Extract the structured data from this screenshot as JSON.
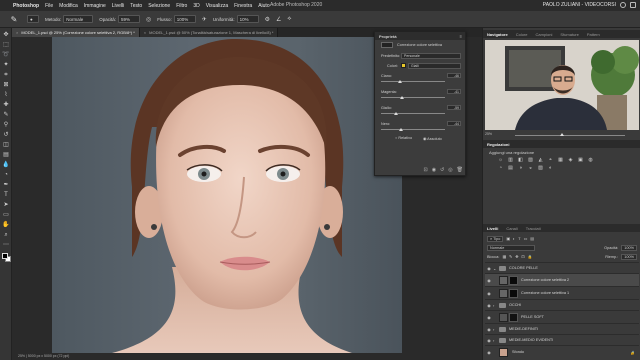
{
  "menubar": {
    "app": "Photoshop",
    "items": [
      "File",
      "Modifica",
      "Immagine",
      "Livelli",
      "Testo",
      "Selezione",
      "Filtro",
      "3D",
      "Visualizza",
      "Finestra",
      "Aiuto"
    ],
    "title": "Adobe Photoshop 2020",
    "user": "PAOLO ZULIANI - VIDEOCORSI"
  },
  "options": {
    "mode_label": "Metodo:",
    "mode_value": "Normale",
    "opacity_label": "Opacità:",
    "opacity_value": "59%",
    "flow_label": "Flusso:",
    "flow_value": "100%",
    "smooth_label": "Uniformità:",
    "smooth_value": "10%"
  },
  "tabs": [
    {
      "label": "MODEL_1.psd @ 25% (Correzione colore selettiva 2, RGB/8*) *",
      "active": true
    },
    {
      "label": "MODEL_1.psd @ 50% (Tonalità/saturazione 1, Maschera di livello/8) *",
      "active": false
    }
  ],
  "status": "25% | 5000 px x 5000 px (72 ppi)",
  "properties": {
    "panel_title": "Proprietà",
    "type_label": "Correzione colore selettiva",
    "preset_label": "Predefinito:",
    "preset_value": "Personale",
    "colors_label": "Colori:",
    "colors_value": "Gialli",
    "colors_swatch": "#e8c82a",
    "sliders": [
      {
        "label": "Ciano:",
        "value": "-46",
        "percent": "%"
      },
      {
        "label": "Magenta:",
        "value": "-41",
        "percent": "%"
      },
      {
        "label": "Giallo:",
        "value": "-59",
        "percent": "%"
      },
      {
        "label": "Nero:",
        "value": "-44",
        "percent": "%"
      }
    ],
    "method_relative": "Relativo",
    "method_absolute": "Assoluto"
  },
  "navigator": {
    "tabs": [
      "Navigatore",
      "Colore",
      "Campioni",
      "Sfumature",
      "Pattern"
    ],
    "zoom": "25%"
  },
  "adjustments": {
    "tabs": [
      "Regolazioni"
    ],
    "title": "Aggiungi una regolazione",
    "icons": [
      "☼",
      "▥",
      "◧",
      "▨",
      "◭",
      "◓",
      "▦",
      "◈",
      "▣",
      "◍",
      "◔",
      "▤",
      "◑",
      "◒",
      "▧",
      "◐",
      "▩",
      "◪",
      "▰",
      "▱"
    ]
  },
  "layers": {
    "tabs": [
      "Livelli",
      "Canali",
      "Tracciati"
    ],
    "filter": "Tipo",
    "blend": "Normale",
    "opacity_label": "Opacità:",
    "opacity_value": "100%",
    "lock_label": "Blocca:",
    "fill_label": "Riemp.:",
    "fill_value": "100%",
    "items": [
      {
        "name": "COLORE PELLE",
        "kind": "group",
        "indent": 0,
        "selected": false
      },
      {
        "name": "Correzione colore selettiva 2",
        "kind": "adjust",
        "indent": 1,
        "selected": true
      },
      {
        "name": "Correzione colore selettiva 1",
        "kind": "adjust",
        "indent": 1,
        "selected": false
      },
      {
        "name": "OCCHI",
        "kind": "group",
        "indent": 0,
        "selected": false
      },
      {
        "name": "PELLE SOFT",
        "kind": "adjust",
        "indent": 0,
        "selected": false
      },
      {
        "name": "MEDIE-DEFINITI",
        "kind": "group",
        "indent": 0,
        "selected": false
      },
      {
        "name": "MEDIE-MEDIO EVIDENTI",
        "kind": "group",
        "indent": 0,
        "selected": false
      },
      {
        "name": "Sfondo",
        "kind": "image",
        "indent": 0,
        "selected": false
      }
    ]
  },
  "colors": {
    "accent": "#e8c82a",
    "background": "#5a646c"
  }
}
